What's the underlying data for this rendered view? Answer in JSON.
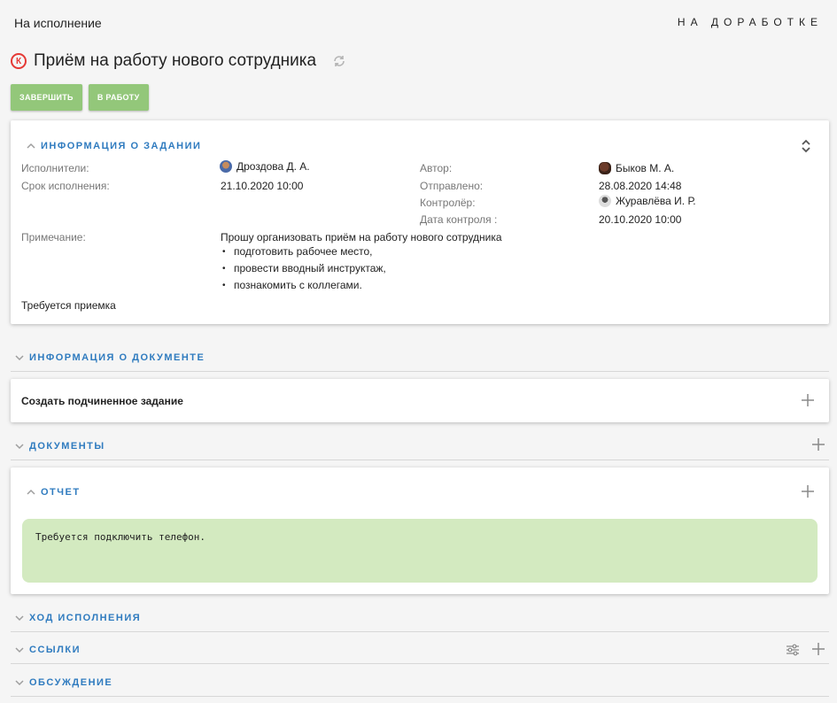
{
  "header": {
    "state": "На исполнение",
    "status": "НА ДОРАБОТКЕ"
  },
  "task": {
    "badge": "К",
    "title": "Приём на работу нового сотрудника"
  },
  "actions": {
    "complete": "ЗАВЕРШИТЬ",
    "in_work": "В РАБОТУ"
  },
  "task_info": {
    "title": "ИНФОРМАЦИЯ О ЗАДАНИИ",
    "executors_label": "Исполнители:",
    "executors_value": "Дроздова Д. А.",
    "deadline_label": "Срок исполнения:",
    "deadline_value": "21.10.2020 10:00",
    "author_label": "Автор:",
    "author_value": "Быков М. А.",
    "sent_label": "Отправлено:",
    "sent_value": "28.08.2020 14:48",
    "controller_label": "Контролёр:",
    "controller_value": "Журавлёва И. Р.",
    "control_date_label": "Дата контроля :",
    "control_date_value": "20.10.2020 10:00",
    "note_label": "Примечание:",
    "note_intro": "Прошу организовать приём на работу нового сотрудника",
    "note_items": [
      "подготовить рабочее место,",
      "провести вводный инструктаж,",
      "познакомить с коллегами."
    ],
    "acceptance": "Требуется приемка"
  },
  "document_info": {
    "title": "ИНФОРМАЦИЯ О ДОКУМЕНТЕ"
  },
  "subtask": {
    "label": "Создать подчиненное задание"
  },
  "documents": {
    "title": "ДОКУМЕНТЫ"
  },
  "report": {
    "title": "ОТЧЕТ",
    "text": "Требуется подключить телефон."
  },
  "progress": {
    "title": "ХОД ИСПОЛНЕНИЯ"
  },
  "links": {
    "title": "ССЫЛКИ"
  },
  "discussion": {
    "title": "ОБСУЖДЕНИЕ"
  },
  "colors": {
    "accent": "#2f7bbf",
    "button": "#93c77a",
    "report_bg": "#d3eac0",
    "badge": "#e53935"
  }
}
